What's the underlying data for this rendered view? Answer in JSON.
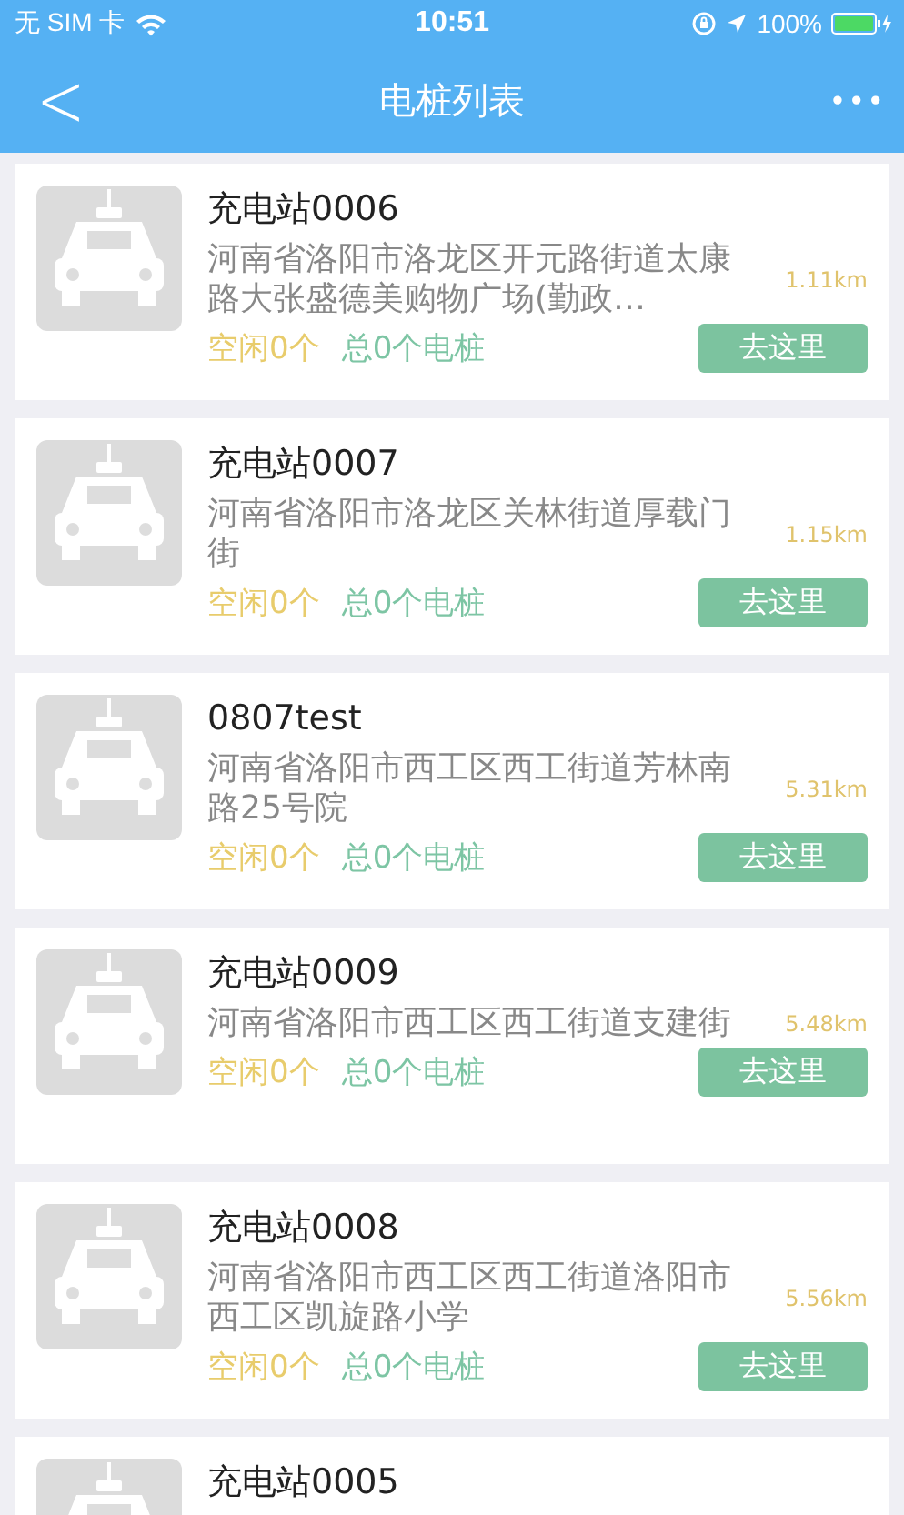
{
  "status_bar": {
    "carrier": "无 SIM 卡",
    "time": "10:51",
    "battery": "100%"
  },
  "nav": {
    "back": "<",
    "title": "电桩列表",
    "more": "•••"
  },
  "stations": [
    {
      "name": "充电站0006",
      "address": "河南省洛阳市洛龙区开元路街道太康路大张盛德美购物广场(勤政…",
      "distance": "1.11km",
      "free": "空闲0个",
      "total": "总0个电桩",
      "action": "去这里"
    },
    {
      "name": "充电站0007",
      "address": "河南省洛阳市洛龙区关林街道厚载门街",
      "distance": "1.15km",
      "free": "空闲0个",
      "total": "总0个电桩",
      "action": "去这里"
    },
    {
      "name": "0807test",
      "address": "河南省洛阳市西工区西工街道芳林南路25号院",
      "distance": "5.31km",
      "free": "空闲0个",
      "total": "总0个电桩",
      "action": "去这里"
    },
    {
      "name": "充电站0009",
      "address": "河南省洛阳市西工区西工街道支建街",
      "distance": "5.48km",
      "free": "空闲0个",
      "total": "总0个电桩",
      "action": "去这里"
    },
    {
      "name": "充电站0008",
      "address": "河南省洛阳市西工区西工街道洛阳市西工区凯旋路小学",
      "distance": "5.56km",
      "free": "空闲0个",
      "total": "总0个电桩",
      "action": "去这里"
    },
    {
      "name": "充电站0005"
    }
  ]
}
